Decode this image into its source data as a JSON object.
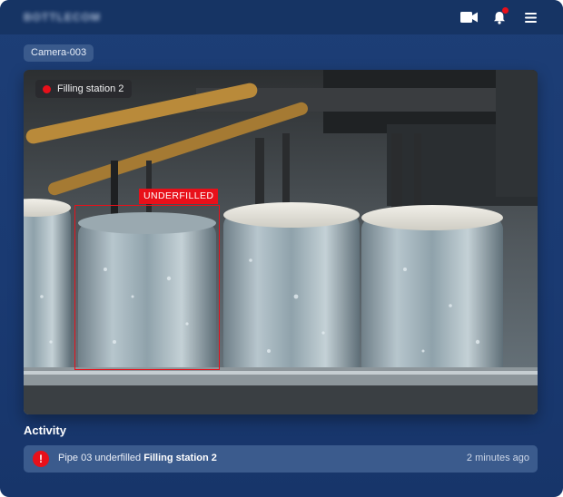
{
  "app": {
    "logo_text": "BOTTLECOM"
  },
  "header": {
    "icons": [
      "video-camera-icon",
      "bell-icon",
      "menu-icon"
    ],
    "notification_dot_color": "#e8101a"
  },
  "camera": {
    "name": "Camera-003"
  },
  "feed": {
    "station_label": "Filling station 2",
    "live_indicator_color": "#e8101a",
    "detection": {
      "label": "UNDERFILLED",
      "color": "#e8101a"
    }
  },
  "activity": {
    "title": "Activity",
    "items": [
      {
        "icon": "alert-icon",
        "message": "Pipe 03 underfilled",
        "location": "Filling station 2",
        "time": "2 minutes ago"
      }
    ]
  },
  "colors": {
    "background": "#1a3a72",
    "alert": "#e8101a",
    "chip": "#3a5a8c"
  }
}
